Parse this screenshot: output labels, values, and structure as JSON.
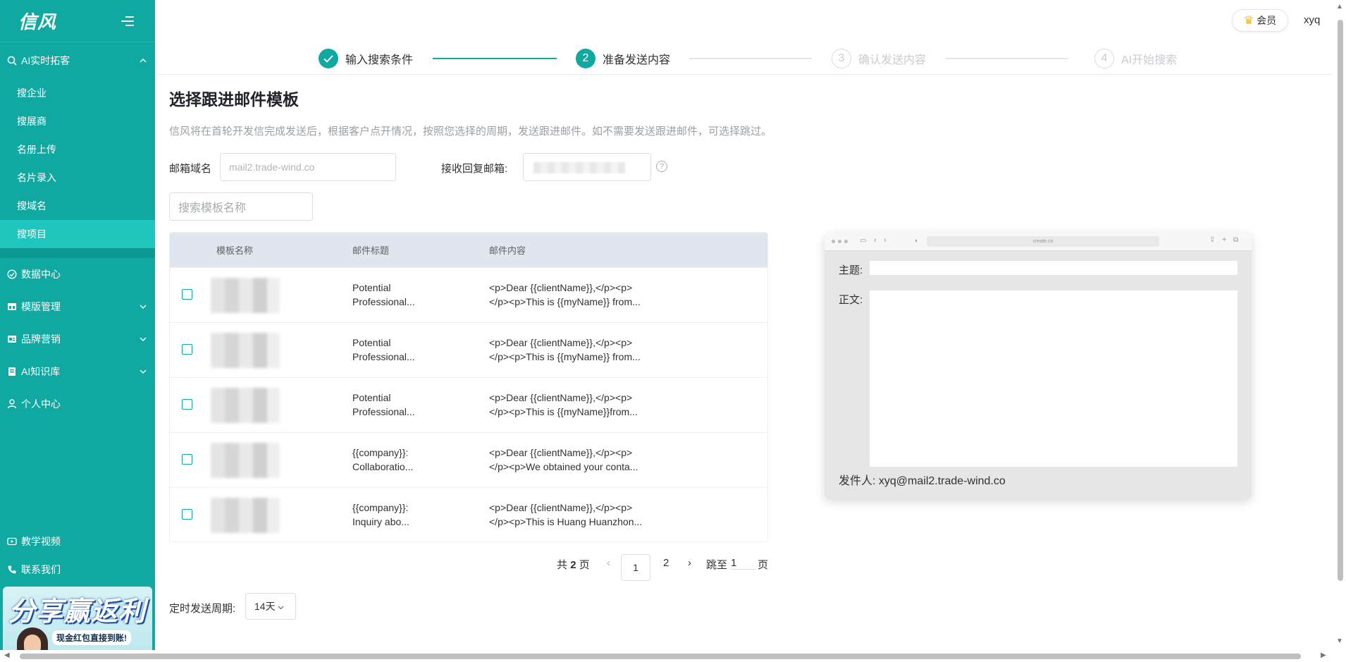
{
  "app": {
    "logo": "信风"
  },
  "sidebar": {
    "group": {
      "label": "AI实时拓客"
    },
    "sub_items": [
      {
        "label": "搜企业"
      },
      {
        "label": "搜展商"
      },
      {
        "label": "名册上传"
      },
      {
        "label": "名片录入"
      },
      {
        "label": "搜域名"
      },
      {
        "label": "搜项目",
        "active": true
      }
    ],
    "items": [
      {
        "label": "数据中心",
        "icon": "dashboard-icon"
      },
      {
        "label": "模版管理",
        "icon": "template-icon"
      },
      {
        "label": "品牌营销",
        "icon": "brand-icon"
      },
      {
        "label": "AI知识库",
        "icon": "book-icon"
      },
      {
        "label": "个人中心",
        "icon": "user-icon"
      }
    ],
    "bottom_items": [
      {
        "label": "教学视频",
        "icon": "video-icon"
      },
      {
        "label": "联系我们",
        "icon": "phone-icon"
      }
    ],
    "promo": {
      "title": "分享赢返利",
      "subtitle": "现金红包直接到账!"
    }
  },
  "header": {
    "vip_label": "会员",
    "username": "xyq"
  },
  "steps": [
    {
      "label": "输入搜索条件",
      "status": "done"
    },
    {
      "num": "2",
      "label": "准备发送内容",
      "status": "current"
    },
    {
      "num": "3",
      "label": "确认发送内容",
      "status": "pending"
    },
    {
      "num": "4",
      "label": "AI开始搜索",
      "status": "pending"
    }
  ],
  "main": {
    "title": "选择跟进邮件模板",
    "description": "信风将在首轮开发信完成发送后，根据客户点开情况，按照您选择的周期，发送跟进邮件。如不需要发送跟进邮件，可选择跳过。",
    "domain_label": "邮箱域名",
    "domain_placeholder": "mail2.trade-wind.co",
    "reply_label": "接收回复邮箱:",
    "search_placeholder": "搜索模板名称"
  },
  "table": {
    "columns": [
      "模板名称",
      "邮件标题",
      "邮件内容"
    ],
    "rows": [
      {
        "subject_1": "Potential",
        "subject_2": "Professional...",
        "content_1": "<p>Dear {{clientName}},</p><p>",
        "content_2": "</p><p>This is {{myName}} from..."
      },
      {
        "subject_1": "Potential",
        "subject_2": "Professional...",
        "content_1": "<p>Dear {{clientName}},</p><p>",
        "content_2": "</p><p>This is {{myName}} from..."
      },
      {
        "subject_1": "Potential",
        "subject_2": "Professional...",
        "content_1": "<p>Dear {{clientName}},</p><p>",
        "content_2": "</p><p>This is {{myName}}from..."
      },
      {
        "subject_1": "{{company}}:",
        "subject_2": "Collaboratio...",
        "content_1": "<p>Dear {{clientName}},</p><p>",
        "content_2": "</p><p>We obtained your conta..."
      },
      {
        "subject_1": "{{company}}:",
        "subject_2": "Inquiry abo...",
        "content_1": "<p>Dear {{clientName}},</p><p>",
        "content_2": "</p><p>This is Huang Huanzhon..."
      }
    ]
  },
  "pagination": {
    "total_prefix": "共",
    "total_pages": "2",
    "total_suffix": "页",
    "prev": "‹",
    "pages": [
      "1",
      "2"
    ],
    "next": "›",
    "jump_label": "跳至",
    "jump_value": "1",
    "jump_suffix": "页"
  },
  "period": {
    "label": "定时发送周期:",
    "value": "14天"
  },
  "preview": {
    "url": "create.co",
    "subject_label": "主题:",
    "body_label": "正文:",
    "sender_label": "发件人:",
    "sender_value": "xyq@mail2.trade-wind.co"
  },
  "colors": {
    "primary": "#0fa9a1",
    "sidebar_active": "#1ec6bd",
    "table_header": "#e1e6ee"
  }
}
